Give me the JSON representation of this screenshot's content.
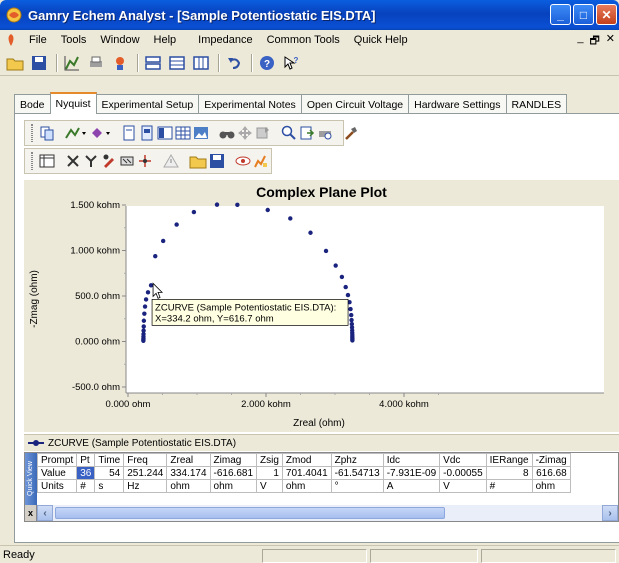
{
  "window": {
    "title": "Gamry Echem Analyst - [Sample Potentiostatic EIS.DTA]",
    "minimize": "_",
    "maximize": "□",
    "close": "✕"
  },
  "menu": [
    "File",
    "Tools",
    "Window",
    "Help",
    "Impedance",
    "Common Tools",
    "Quick Help"
  ],
  "mdi_controls": {
    "minimize": "_",
    "restore": "🗗",
    "close": "✕"
  },
  "tabs": [
    "Bode",
    "Nyquist",
    "Experimental Setup",
    "Experimental Notes",
    "Open Circuit Voltage",
    "Hardware Settings",
    "RANDLES"
  ],
  "active_tab": "Nyquist",
  "chart_data": {
    "type": "scatter",
    "title": "Complex Plane Plot",
    "xlabel": "Zreal (ohm)",
    "ylabel": "-Zmag (ohm)",
    "xlim": [
      0,
      5000
    ],
    "ylim": [
      -500,
      1500
    ],
    "xticks": [
      {
        "v": 0,
        "label": "0.000 ohm"
      },
      {
        "v": 2000,
        "label": "2.000 kohm"
      },
      {
        "v": 4000,
        "label": "4.000 kohm"
      }
    ],
    "yticks": [
      {
        "v": 1500,
        "label": "1.500 kohm"
      },
      {
        "v": 1000,
        "label": "1.000 kohm"
      },
      {
        "v": 500,
        "label": "500.0 ohm"
      },
      {
        "v": 0,
        "label": "0.000 ohm"
      },
      {
        "v": -500,
        "label": "-500.0 ohm"
      }
    ],
    "series": [
      {
        "name": "ZCURVE (Sample Potentiostatic EIS.DTA)",
        "color": "#1a237e",
        "points": [
          [
            1585,
            1502
          ],
          [
            1290,
            1504
          ],
          [
            2025,
            1445
          ],
          [
            2352,
            1352
          ],
          [
            955,
            1422
          ],
          [
            2645,
            1195
          ],
          [
            705,
            1285
          ],
          [
            2870,
            995
          ],
          [
            510,
            1105
          ],
          [
            3010,
            835
          ],
          [
            395,
            938
          ],
          [
            3100,
            710
          ],
          [
            334,
            617
          ],
          [
            290,
            540
          ],
          [
            262,
            462
          ],
          [
            3155,
            598
          ],
          [
            3188,
            510
          ],
          [
            247,
            384
          ],
          [
            237,
            306
          ],
          [
            3210,
            432
          ],
          [
            3225,
            356
          ],
          [
            230,
            228
          ],
          [
            228,
            165
          ],
          [
            3235,
            290
          ],
          [
            3240,
            236
          ],
          [
            226,
            120
          ],
          [
            225,
            82
          ],
          [
            3244,
            192
          ],
          [
            3247,
            155
          ],
          [
            224,
            55
          ],
          [
            224,
            35
          ],
          [
            3249,
            122
          ],
          [
            3250,
            95
          ],
          [
            223,
            20
          ],
          [
            223,
            8
          ],
          [
            3251,
            72
          ],
          [
            3251,
            52
          ],
          [
            3252,
            36
          ],
          [
            3252,
            22
          ],
          [
            3252,
            12
          ]
        ]
      }
    ],
    "annotation": {
      "line1": "ZCURVE (Sample Potentiostatic EIS.DTA):",
      "line2": "X=334.2 ohm, Y=616.7 ohm",
      "x": 334.2,
      "y": 616.7
    }
  },
  "legend": {
    "label": "ZCURVE (Sample Potentiostatic EIS.DTA)"
  },
  "quickview": {
    "side_label": "Quick View",
    "headers": [
      "Prompt",
      "Pt",
      "Time",
      "Freq",
      "Zreal",
      "Zimag",
      "Zsig",
      "Zmod",
      "Zphz",
      "Idc",
      "Vdc",
      "IERange",
      "-Zimag"
    ],
    "values": [
      "Value",
      "36",
      "54",
      "251.244",
      "334.174",
      "-616.681",
      "1",
      "701.4041",
      "-61.54713",
      "-7.931E-09",
      "-0.00055",
      "8",
      "616.68"
    ],
    "units": [
      "Units",
      "#",
      "s",
      "Hz",
      "ohm",
      "ohm",
      "V",
      "ohm",
      "°",
      "A",
      "V",
      "#",
      "ohm"
    ],
    "close_label": "x"
  },
  "status": {
    "text": "Ready"
  }
}
